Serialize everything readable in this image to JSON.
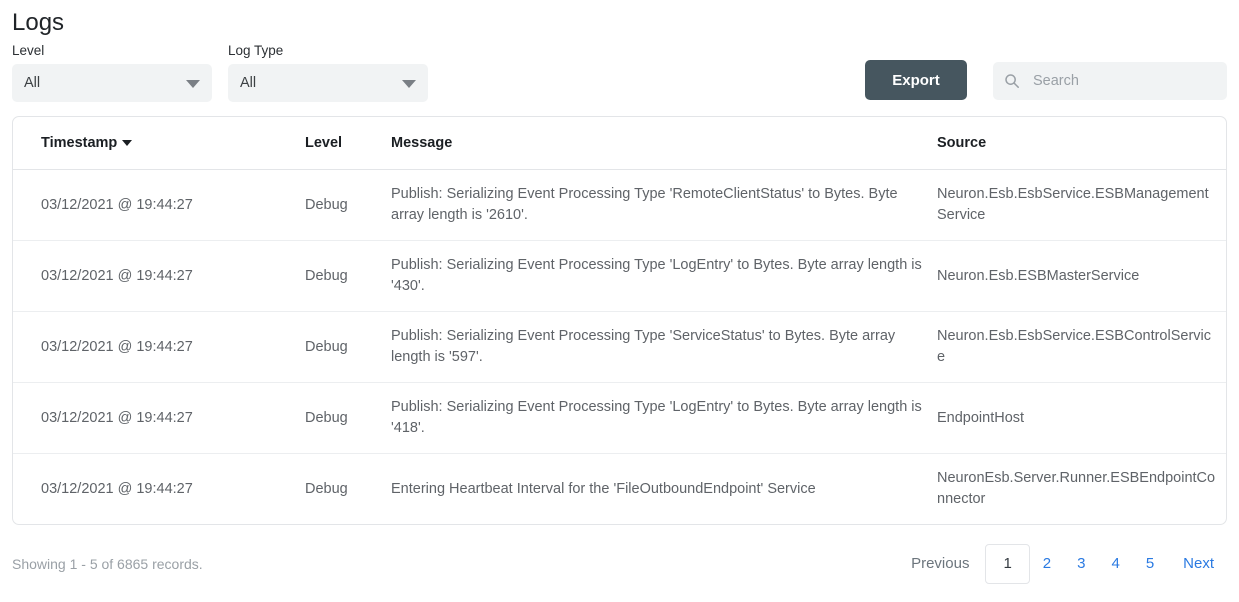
{
  "page_title": "Logs",
  "filters": [
    {
      "label": "Level",
      "value": "All",
      "name": "level"
    },
    {
      "label": "Log Type",
      "value": "All",
      "name": "log-type"
    }
  ],
  "toolbar": {
    "export_label": "Export",
    "search_placeholder": "Search",
    "search_value": "",
    "search_icon": "search-icon",
    "export_color": "#46565f"
  },
  "table": {
    "columns": [
      {
        "key": "timestamp",
        "label": "Timestamp",
        "sorted": true,
        "sort_dir": "desc"
      },
      {
        "key": "level",
        "label": "Level",
        "sorted": false
      },
      {
        "key": "message",
        "label": "Message",
        "sorted": false
      },
      {
        "key": "source",
        "label": "Source",
        "sorted": false
      }
    ],
    "rows": [
      {
        "timestamp": "03/12/2021 @ 19:44:27",
        "level": "Debug",
        "message": "Publish: Serializing Event Processing Type 'RemoteClientStatus' to Bytes. Byte array length is '2610'.",
        "source": "Neuron.Esb.EsbService.ESBManagementService"
      },
      {
        "timestamp": "03/12/2021 @ 19:44:27",
        "level": "Debug",
        "message": "Publish: Serializing Event Processing Type 'LogEntry' to Bytes. Byte array length is '430'.",
        "source": "Neuron.Esb.ESBMasterService"
      },
      {
        "timestamp": "03/12/2021 @ 19:44:27",
        "level": "Debug",
        "message": "Publish: Serializing Event Processing Type 'ServiceStatus' to Bytes. Byte array length is '597'.",
        "source": "Neuron.Esb.EsbService.ESBControlService"
      },
      {
        "timestamp": "03/12/2021 @ 19:44:27",
        "level": "Debug",
        "message": "Publish: Serializing Event Processing Type 'LogEntry' to Bytes. Byte array length is '418'.",
        "source": "EndpointHost"
      },
      {
        "timestamp": "03/12/2021 @ 19:44:27",
        "level": "Debug",
        "message": "Entering Heartbeat Interval for the 'FileOutboundEndpoint' Service",
        "source": "NeuronEsb.Server.Runner.ESBEndpointConnector"
      }
    ]
  },
  "footer": {
    "records_text": "Showing 1 - 5 of 6865 records.",
    "pagination": {
      "previous_label": "Previous",
      "next_label": "Next",
      "pages": [
        "1",
        "2",
        "3",
        "4",
        "5"
      ],
      "active_page": "1",
      "link_color": "#2a7ae2"
    }
  }
}
